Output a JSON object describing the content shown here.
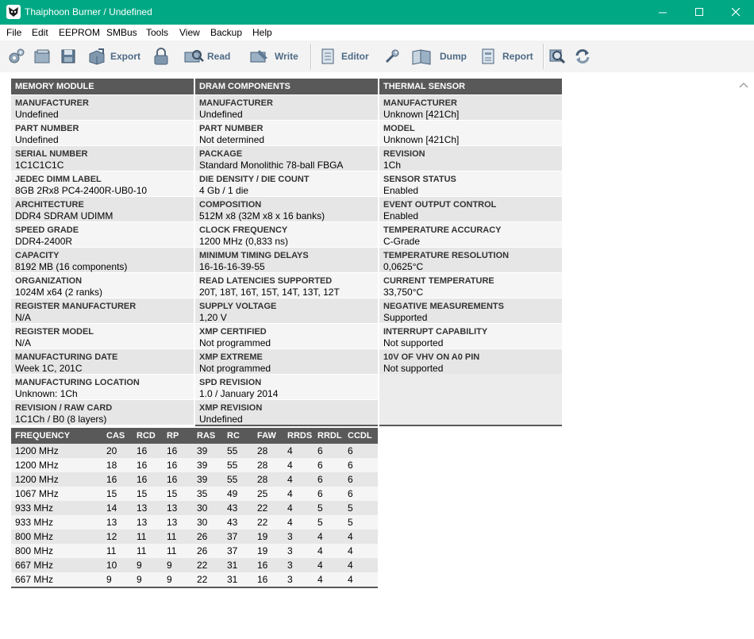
{
  "window": {
    "title": "Thaiphoon Burner / Undefined"
  },
  "menu": [
    "File",
    "Edit",
    "EEPROM",
    "SMBus",
    "Tools",
    "View",
    "Backup",
    "Help"
  ],
  "toolbar": {
    "export": "Export",
    "read": "Read",
    "write": "Write",
    "editor": "Editor",
    "dump": "Dump",
    "report": "Report"
  },
  "memory_module": {
    "header": "MEMORY MODULE",
    "rows": [
      {
        "k": "MANUFACTURER",
        "v": "Undefined"
      },
      {
        "k": "PART NUMBER",
        "v": "Undefined"
      },
      {
        "k": "SERIAL NUMBER",
        "v": "1C1C1C1C"
      },
      {
        "k": "JEDEC DIMM LABEL",
        "v": "8GB 2Rx8 PC4-2400R-UB0-10"
      },
      {
        "k": "ARCHITECTURE",
        "v": "DDR4 SDRAM UDIMM"
      },
      {
        "k": "SPEED GRADE",
        "v": "DDR4-2400R"
      },
      {
        "k": "CAPACITY",
        "v": "8192 MB (16 components)"
      },
      {
        "k": "ORGANIZATION",
        "v": "1024M x64 (2 ranks)"
      },
      {
        "k": "REGISTER MANUFACTURER",
        "v": "N/A"
      },
      {
        "k": "REGISTER MODEL",
        "v": "N/A"
      },
      {
        "k": "MANUFACTURING DATE",
        "v": "Week 1C, 201C"
      },
      {
        "k": "MANUFACTURING LOCATION",
        "v": "Unknown: 1Ch"
      },
      {
        "k": "REVISION / RAW CARD",
        "v": "1C1Ch / B0 (8 layers)"
      }
    ]
  },
  "dram_components": {
    "header": "DRAM COMPONENTS",
    "rows": [
      {
        "k": "MANUFACTURER",
        "v": "Undefined"
      },
      {
        "k": "PART NUMBER",
        "v": "Not determined"
      },
      {
        "k": "PACKAGE",
        "v": "Standard Monolithic 78-ball FBGA"
      },
      {
        "k": "DIE DENSITY / DIE COUNT",
        "v": "4 Gb / 1 die"
      },
      {
        "k": "COMPOSITION",
        "v": "512M x8 (32M x8 x 16 banks)"
      },
      {
        "k": "CLOCK FREQUENCY",
        "v": "1200 MHz (0,833 ns)"
      },
      {
        "k": "MINIMUM TIMING DELAYS",
        "v": "16-16-16-39-55"
      },
      {
        "k": "READ LATENCIES SUPPORTED",
        "v": "20T, 18T, 16T, 15T, 14T, 13T, 12T"
      },
      {
        "k": "SUPPLY VOLTAGE",
        "v": "1,20 V"
      },
      {
        "k": "XMP CERTIFIED",
        "v": "Not programmed"
      },
      {
        "k": "XMP EXTREME",
        "v": "Not programmed"
      },
      {
        "k": "SPD REVISION",
        "v": "1.0 / January 2014"
      },
      {
        "k": "XMP REVISION",
        "v": "Undefined"
      }
    ]
  },
  "thermal_sensor": {
    "header": "THERMAL SENSOR",
    "rows": [
      {
        "k": "MANUFACTURER",
        "v": "Unknown [421Ch]"
      },
      {
        "k": "MODEL",
        "v": "Unknown [421Ch]"
      },
      {
        "k": "REVISION",
        "v": "1Ch"
      },
      {
        "k": "SENSOR STATUS",
        "v": "Enabled"
      },
      {
        "k": "EVENT OUTPUT CONTROL",
        "v": "Enabled"
      },
      {
        "k": "TEMPERATURE ACCURACY",
        "v": "C-Grade"
      },
      {
        "k": "TEMPERATURE RESOLUTION",
        "v": "0,0625°C"
      },
      {
        "k": "CURRENT TEMPERATURE",
        "v": "33,750°C"
      },
      {
        "k": "NEGATIVE MEASUREMENTS",
        "v": "Supported"
      },
      {
        "k": "INTERRUPT CAPABILITY",
        "v": "Not supported"
      },
      {
        "k": "10V OF VHV ON A0 PIN",
        "v": "Not supported"
      }
    ]
  },
  "timings": {
    "headers": [
      "FREQUENCY",
      "CAS",
      "RCD",
      "RP",
      "RAS",
      "RC",
      "FAW",
      "RRDS",
      "RRDL",
      "CCDL"
    ],
    "rows": [
      [
        "1200 MHz",
        "20",
        "16",
        "16",
        "39",
        "55",
        "28",
        "4",
        "6",
        "6"
      ],
      [
        "1200 MHz",
        "18",
        "16",
        "16",
        "39",
        "55",
        "28",
        "4",
        "6",
        "6"
      ],
      [
        "1200 MHz",
        "16",
        "16",
        "16",
        "39",
        "55",
        "28",
        "4",
        "6",
        "6"
      ],
      [
        "1067 MHz",
        "15",
        "15",
        "15",
        "35",
        "49",
        "25",
        "4",
        "6",
        "6"
      ],
      [
        "933 MHz",
        "14",
        "13",
        "13",
        "30",
        "43",
        "22",
        "4",
        "5",
        "5"
      ],
      [
        "933 MHz",
        "13",
        "13",
        "13",
        "30",
        "43",
        "22",
        "4",
        "5",
        "5"
      ],
      [
        "800 MHz",
        "12",
        "11",
        "11",
        "26",
        "37",
        "19",
        "3",
        "4",
        "4"
      ],
      [
        "800 MHz",
        "11",
        "11",
        "11",
        "26",
        "37",
        "19",
        "3",
        "4",
        "4"
      ],
      [
        "667 MHz",
        "10",
        "9",
        "9",
        "22",
        "31",
        "16",
        "3",
        "4",
        "4"
      ],
      [
        "667 MHz",
        "9",
        "9",
        "9",
        "22",
        "31",
        "16",
        "3",
        "4",
        "4"
      ]
    ]
  }
}
